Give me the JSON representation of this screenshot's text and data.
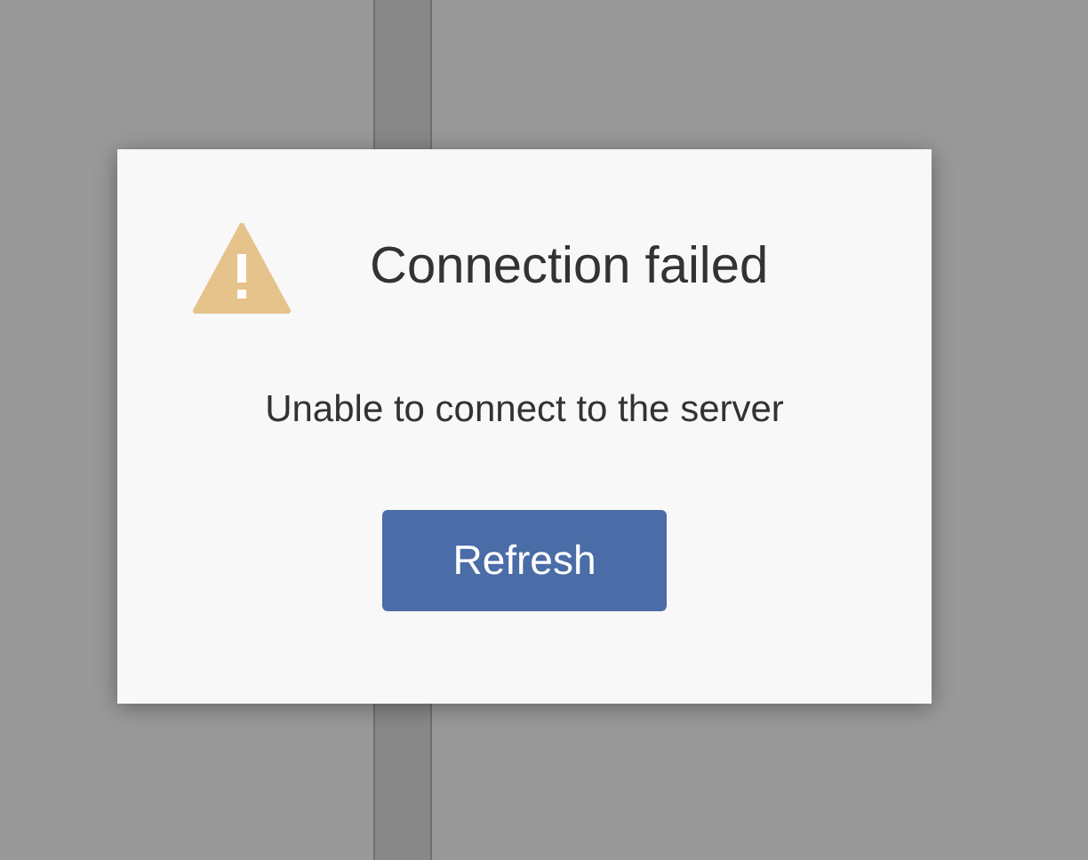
{
  "dialog": {
    "title": "Connection failed",
    "message": "Unable to connect to the server",
    "button": "Refresh"
  }
}
